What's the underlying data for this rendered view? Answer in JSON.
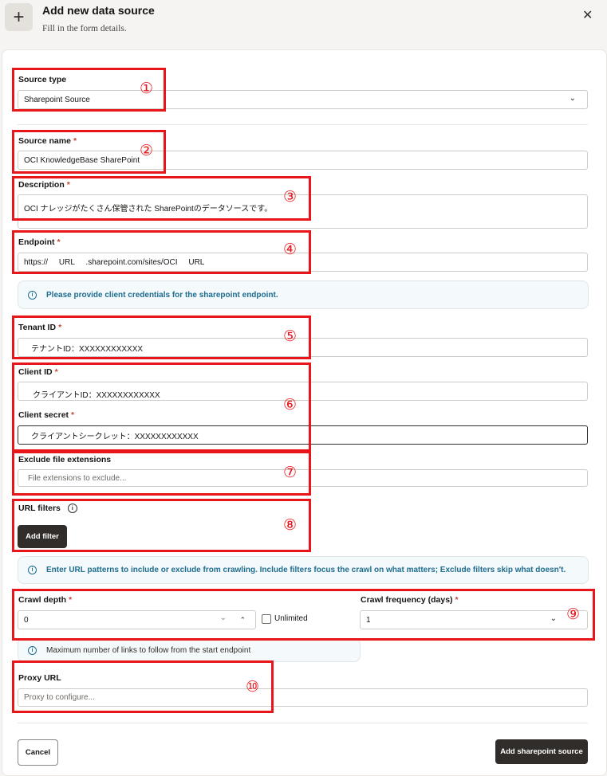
{
  "header": {
    "title": "Add new data source",
    "subtitle": "Fill in the form details.",
    "add_icon": "plus-icon",
    "close_icon": "close-icon"
  },
  "form": {
    "source_type": {
      "label": "Source type",
      "value": "Sharepoint Source"
    },
    "source_name": {
      "label": "Source name",
      "value": "OCI KnowledgeBase SharePoint"
    },
    "description": {
      "label": "Description",
      "value": "OCI ナレッジがたくさん保管された SharePointのデータソースです。"
    },
    "endpoint": {
      "label": "Endpoint",
      "value": "https://     URL     .sharepoint.com/sites/OCI     URL"
    },
    "credentials_info": "Please provide client credentials for the sharepoint endpoint.",
    "tenant_id": {
      "label": "Tenant ID",
      "value": "テナントID：XXXXXXXXXXXX"
    },
    "client_id": {
      "label": "Client ID",
      "value": "クライアントID：XXXXXXXXXXXX"
    },
    "client_secret": {
      "label": "Client secret",
      "value": "クライアントシークレット：XXXXXXXXXXXX"
    },
    "exclude_ext": {
      "label": "Exclude file extensions",
      "placeholder": "File extensions to exclude..."
    },
    "url_filters": {
      "label": "URL filters",
      "add_filter": "Add filter"
    },
    "url_filters_info": "Enter URL patterns to include or exclude from crawling. Include filters focus the crawl on what matters; Exclude filters skip what doesn't.",
    "crawl_depth": {
      "label": "Crawl depth",
      "value": "0",
      "unlimited_label": "Unlimited",
      "info": "Maximum number of links to follow from the start endpoint"
    },
    "crawl_frequency": {
      "label": "Crawl frequency (days)",
      "value": "1"
    },
    "proxy_url": {
      "label": "Proxy URL",
      "placeholder": "Proxy to configure..."
    },
    "required_mark": "*"
  },
  "footer": {
    "cancel": "Cancel",
    "submit": "Add sharepoint source"
  },
  "annotations": [
    "①",
    "②",
    "③",
    "④",
    "⑤",
    "⑥",
    "⑦",
    "⑧",
    "⑨",
    "⑩"
  ],
  "colors": {
    "accent_dark": "#312d2a",
    "required": "#c74634",
    "annotation_red": "#e8151b",
    "info_text": "#1e6d8f"
  }
}
